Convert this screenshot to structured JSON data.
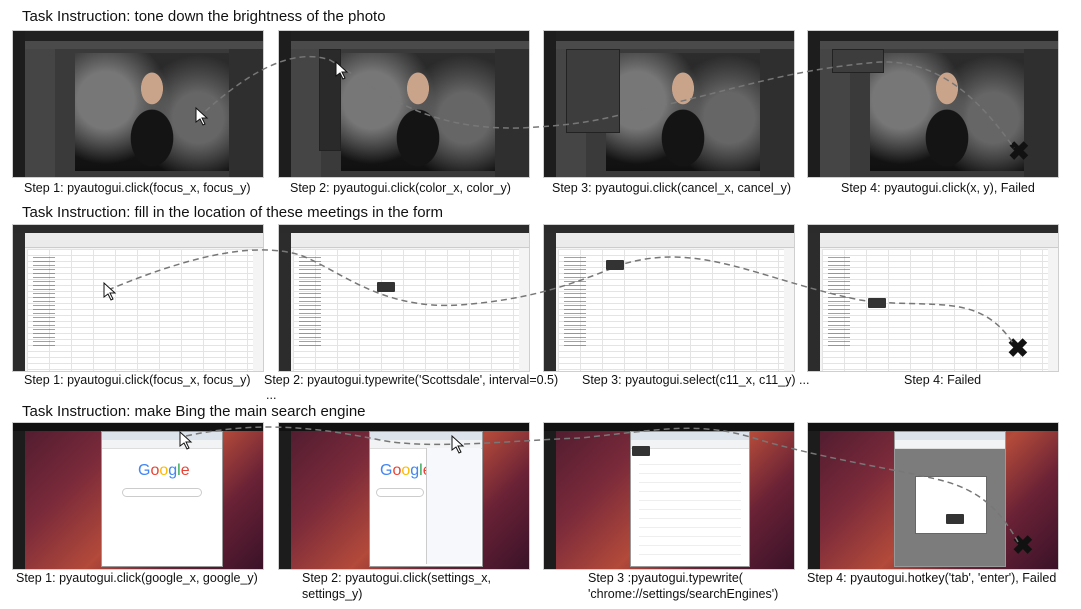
{
  "rows": [
    {
      "title": "Task Instruction: tone down the brightness of the photo",
      "steps": [
        "Step 1: pyautogui.click(focus_x, focus_y)",
        "Step 2: pyautogui.click(color_x, color_y)",
        "Step 3: pyautogui.click(cancel_x, cancel_y)",
        "Step 4: pyautogui.click(x, y), Failed"
      ]
    },
    {
      "title": "Task Instruction: fill in the location of these meetings in the form",
      "steps": [
        "Step 1: pyautogui.click(focus_x, focus_y)",
        "Step 2: pyautogui.typewrite('Scottsdale', interval=0.5)",
        "Step 3: pyautogui.select(c11_x, c11_y) ...",
        "Step 4: Failed"
      ],
      "step2_continuation": "..."
    },
    {
      "title": "Task Instruction: make Bing the main search engine",
      "steps": [
        "Step 1: pyautogui.click(google_x, google_y)",
        "Step 2: pyautogui.click(settings_x, settings_y)",
        "Step 3 :pyautogui.typewrite( 'chrome://settings/searchEngines')",
        "Step 4: pyautogui.hotkey('tab', 'enter'), Failed"
      ]
    }
  ],
  "google_logo": [
    "G",
    "o",
    "o",
    "g",
    "l",
    "e"
  ],
  "fail_mark": "✖",
  "colors": {
    "gimp_bg": "#3a3a3a",
    "calc_bg": "#ffffff",
    "ubuntu_wallpaper": "#7a2a3a",
    "trajectory": "#777777"
  }
}
